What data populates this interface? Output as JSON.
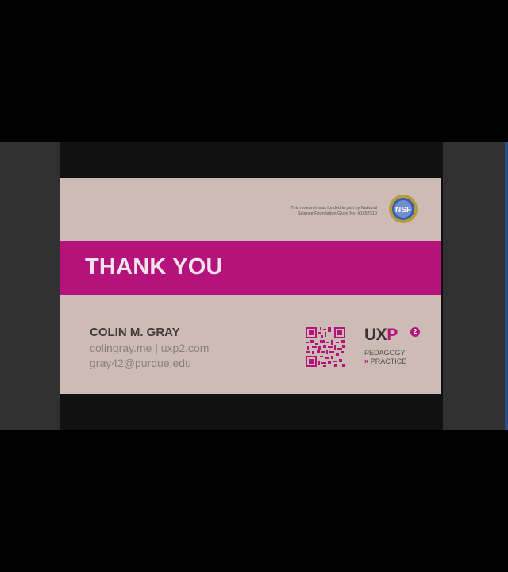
{
  "slide": {
    "funding_line1": "This research was funded in part by National",
    "funding_line2": "Science Foundation Grant No. #1657310",
    "nsf_logo_text": "NSF",
    "title": "THANK YOU",
    "presenter_name": "COLIN M. GRAY",
    "websites": "colingray.me | uxp2.com",
    "email": "gray42@purdue.edu",
    "uxp_logo": {
      "text_ux": "UX",
      "text_p": "P",
      "superscript": "2",
      "line1": "PEDAGOGY",
      "line2_symbol": "×",
      "line2_text": "PRACTICE"
    }
  },
  "colors": {
    "accent_magenta": "#b5137b",
    "slide_background": "#cdbcb5",
    "side_panels": "#303030",
    "letterbox": "#000000"
  },
  "icons": {
    "nsf": "nsf-logo-icon",
    "qr": "qr-code-icon"
  }
}
